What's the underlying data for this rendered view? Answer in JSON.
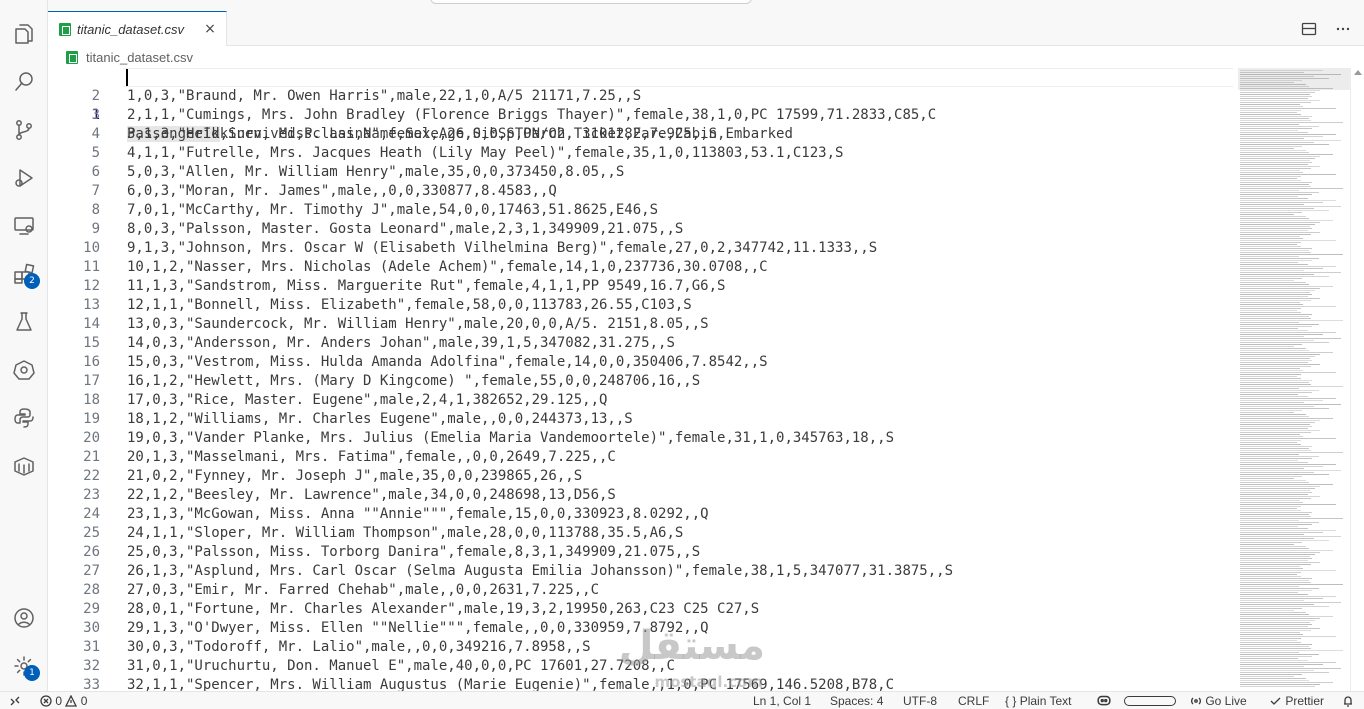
{
  "tab": {
    "label": "titanic_dataset.csv",
    "close_icon": "×"
  },
  "breadcrumb": {
    "file": "titanic_dataset.csv"
  },
  "activity_badges": {
    "extensions": "2",
    "settings": "1"
  },
  "editor": {
    "active_line": 1,
    "selected_word": "PassengerId",
    "lines": [
      {
        "n": "1",
        "t": ",Survived,Pclass,Name,Sex,Age,SibSp,Parch,Ticket,Fare,Cabin,Embarked"
      },
      {
        "n": "2",
        "t": "1,0,3,\"Braund, Mr. Owen Harris\",male,22,1,0,A/5 21171,7.25,,S"
      },
      {
        "n": "3",
        "t": "2,1,1,\"Cumings, Mrs. John Bradley (Florence Briggs Thayer)\",female,38,1,0,PC 17599,71.2833,C85,C"
      },
      {
        "n": "4",
        "t": "3,1,3,\"Heikkinen, Miss. Laina\",female,26,0,0,STON/O2. 3101282,7.925,,S"
      },
      {
        "n": "5",
        "t": "4,1,1,\"Futrelle, Mrs. Jacques Heath (Lily May Peel)\",female,35,1,0,113803,53.1,C123,S"
      },
      {
        "n": "6",
        "t": "5,0,3,\"Allen, Mr. William Henry\",male,35,0,0,373450,8.05,,S"
      },
      {
        "n": "7",
        "t": "6,0,3,\"Moran, Mr. James\",male,,0,0,330877,8.4583,,Q"
      },
      {
        "n": "8",
        "t": "7,0,1,\"McCarthy, Mr. Timothy J\",male,54,0,0,17463,51.8625,E46,S"
      },
      {
        "n": "9",
        "t": "8,0,3,\"Palsson, Master. Gosta Leonard\",male,2,3,1,349909,21.075,,S"
      },
      {
        "n": "10",
        "t": "9,1,3,\"Johnson, Mrs. Oscar W (Elisabeth Vilhelmina Berg)\",female,27,0,2,347742,11.1333,,S"
      },
      {
        "n": "11",
        "t": "10,1,2,\"Nasser, Mrs. Nicholas (Adele Achem)\",female,14,1,0,237736,30.0708,,C"
      },
      {
        "n": "12",
        "t": "11,1,3,\"Sandstrom, Miss. Marguerite Rut\",female,4,1,1,PP 9549,16.7,G6,S"
      },
      {
        "n": "13",
        "t": "12,1,1,\"Bonnell, Miss. Elizabeth\",female,58,0,0,113783,26.55,C103,S"
      },
      {
        "n": "14",
        "t": "13,0,3,\"Saundercock, Mr. William Henry\",male,20,0,0,A/5. 2151,8.05,,S"
      },
      {
        "n": "15",
        "t": "14,0,3,\"Andersson, Mr. Anders Johan\",male,39,1,5,347082,31.275,,S"
      },
      {
        "n": "16",
        "t": "15,0,3,\"Vestrom, Miss. Hulda Amanda Adolfina\",female,14,0,0,350406,7.8542,,S"
      },
      {
        "n": "17",
        "t": "16,1,2,\"Hewlett, Mrs. (Mary D Kingcome) \",female,55,0,0,248706,16,,S"
      },
      {
        "n": "18",
        "t": "17,0,3,\"Rice, Master. Eugene\",male,2,4,1,382652,29.125,,Q"
      },
      {
        "n": "19",
        "t": "18,1,2,\"Williams, Mr. Charles Eugene\",male,,0,0,244373,13,,S"
      },
      {
        "n": "20",
        "t": "19,0,3,\"Vander Planke, Mrs. Julius (Emelia Maria Vandemoortele)\",female,31,1,0,345763,18,,S"
      },
      {
        "n": "21",
        "t": "20,1,3,\"Masselmani, Mrs. Fatima\",female,,0,0,2649,7.225,,C"
      },
      {
        "n": "22",
        "t": "21,0,2,\"Fynney, Mr. Joseph J\",male,35,0,0,239865,26,,S"
      },
      {
        "n": "23",
        "t": "22,1,2,\"Beesley, Mr. Lawrence\",male,34,0,0,248698,13,D56,S"
      },
      {
        "n": "24",
        "t": "23,1,3,\"McGowan, Miss. Anna \"\"Annie\"\"\",female,15,0,0,330923,8.0292,,Q"
      },
      {
        "n": "25",
        "t": "24,1,1,\"Sloper, Mr. William Thompson\",male,28,0,0,113788,35.5,A6,S"
      },
      {
        "n": "26",
        "t": "25,0,3,\"Palsson, Miss. Torborg Danira\",female,8,3,1,349909,21.075,,S"
      },
      {
        "n": "27",
        "t": "26,1,3,\"Asplund, Mrs. Carl Oscar (Selma Augusta Emilia Johansson)\",female,38,1,5,347077,31.3875,,S"
      },
      {
        "n": "28",
        "t": "27,0,3,\"Emir, Mr. Farred Chehab\",male,,0,0,2631,7.225,,C"
      },
      {
        "n": "29",
        "t": "28,0,1,\"Fortune, Mr. Charles Alexander\",male,19,3,2,19950,263,C23 C25 C27,S"
      },
      {
        "n": "30",
        "t": "29,1,3,\"O'Dwyer, Miss. Ellen \"\"Nellie\"\"\",female,,0,0,330959,7.8792,,Q"
      },
      {
        "n": "31",
        "t": "30,0,3,\"Todoroff, Mr. Lalio\",male,,0,0,349216,7.8958,,S"
      },
      {
        "n": "32",
        "t": "31,0,1,\"Uruchurtu, Don. Manuel E\",male,40,0,0,PC 17601,27.7208,,C"
      },
      {
        "n": "33",
        "t": "32,1,1,\"Spencer, Mrs. William Augustus (Marie Eugenie)\",female,,1,0,PC 17569,146.5208,B78,C"
      }
    ]
  },
  "watermark": {
    "arabic": "مستقل",
    "latin": "mostaql.com"
  },
  "statusbar": {
    "errors": "0",
    "warnings": "0",
    "position": "Ln 1, Col 1",
    "spaces": "Spaces: 4",
    "encoding": "UTF-8",
    "eol": "CRLF",
    "language": "Plain Text",
    "golive": "Go Live",
    "prettier": "Prettier"
  },
  "colors": {
    "accent": "#005fb8",
    "csv_icon": "#1f9e4a",
    "line_number_active": "#171184"
  }
}
